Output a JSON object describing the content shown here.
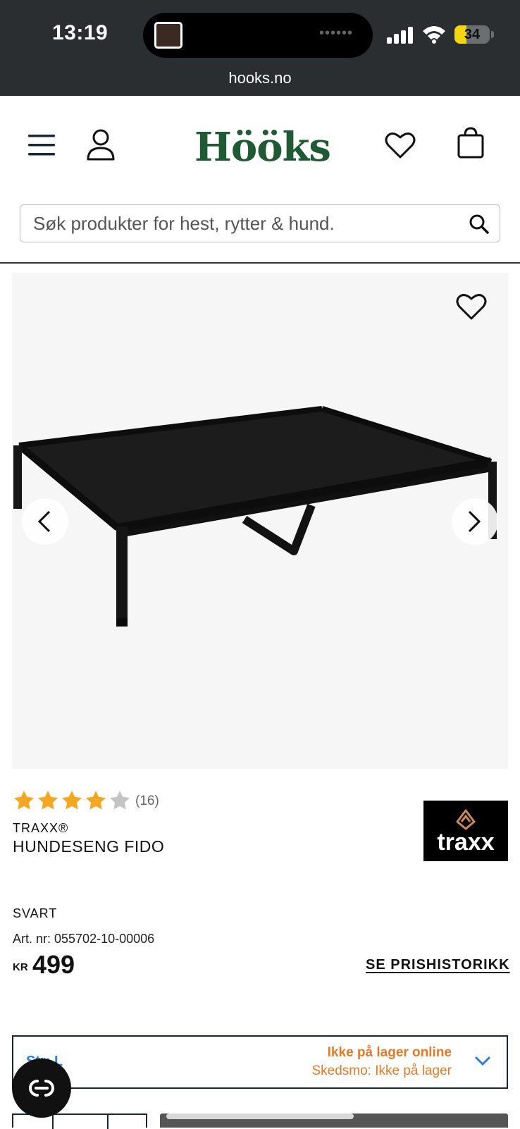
{
  "status_bar": {
    "time": "13:19",
    "battery": "34",
    "battery_level": 0.34,
    "url": "hooks.no"
  },
  "header": {
    "logo": "Hööks",
    "search_placeholder": "Søk produkter for hest, rytter & hund."
  },
  "product": {
    "rating_stars": 4,
    "rating_count": "(16)",
    "brand": "TRAXX®",
    "name": "HUNDESENG FIDO",
    "brand_logo_text": "traxx",
    "color": "SVART",
    "art_nr": "Art. nr: 055702-10-00006",
    "currency": "KR",
    "price": "499",
    "price_history": "SE PRISHISTORIKK"
  },
  "size_selector": {
    "label": "Str: L",
    "stock_online": "Ikke på lager online",
    "stock_store": "Skedsmo: Ikke på lager"
  },
  "colors": {
    "brand_green": "#1f5a35",
    "star": "#f5a623",
    "stock_orange": "#e07b2c",
    "link_blue": "#2d7fd8"
  },
  "icons": [
    "menu-icon",
    "user-icon",
    "heart-icon",
    "bag-icon",
    "search-icon",
    "chevron-left-icon",
    "chevron-right-icon",
    "chevron-down-icon",
    "chat-icon"
  ]
}
